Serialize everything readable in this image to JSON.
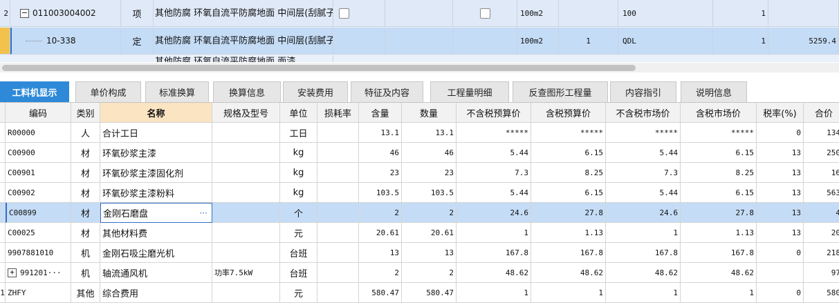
{
  "upper": {
    "rows": [
      {
        "gutter": "2",
        "code": "011003004002",
        "expand": "−",
        "type": "项",
        "name": "其他防腐 环氧自流平防腐地面 中间层(刮腻子)",
        "unit": "100m2",
        "qty_expr": "",
        "qty": "100",
        "col_a": "",
        "count": "1",
        "total": ""
      },
      {
        "gutter": "",
        "code": "10-338",
        "expand": "",
        "type": "定",
        "name": "其他防腐 环氧自流平防腐地面 中间层(刮腻子)",
        "unit": "100m2",
        "qty_expr": "1",
        "qty": "QDL",
        "col_a": "",
        "count": "1",
        "total": "5259.4"
      },
      {
        "gutter": "",
        "code": "",
        "expand": "",
        "type": "",
        "name": "其他防腐 环氧自流平防腐地面 面漆",
        "unit": "",
        "qty_expr": "",
        "qty": "",
        "col_a": "",
        "count": "",
        "total": ""
      }
    ]
  },
  "tabs": [
    {
      "label": "工料机显示",
      "active": true
    },
    {
      "label": "单价构成"
    },
    {
      "label": "标准换算"
    },
    {
      "label": "换算信息"
    },
    {
      "label": "安装费用"
    },
    {
      "label": "特征及内容"
    },
    {
      "label": "工程量明细"
    },
    {
      "label": "反查图形工程量"
    },
    {
      "label": "内容指引"
    },
    {
      "label": "说明信息"
    }
  ],
  "lower": {
    "headers": [
      "编码",
      "类别",
      "名称",
      "规格及型号",
      "单位",
      "损耗率",
      "含量",
      "数量",
      "不含税预算价",
      "含税预算价",
      "不含税市场价",
      "含税市场价",
      "税率(%)",
      "合价"
    ],
    "rows": [
      {
        "gutter": "",
        "code": "R00000",
        "cat": "人",
        "name": "合计工日",
        "spec": "",
        "unit": "工日",
        "loss": "",
        "content": "13.1",
        "qty": "13.1",
        "p1": "*****",
        "p2": "*****",
        "p3": "*****",
        "p4": "*****",
        "tax": "0",
        "sum": "134"
      },
      {
        "gutter": "",
        "code": "C00900",
        "cat": "材",
        "name": "环氧砂浆主漆",
        "spec": "",
        "unit": "kg",
        "loss": "",
        "content": "46",
        "qty": "46",
        "p1": "5.44",
        "p2": "6.15",
        "p3": "5.44",
        "p4": "6.15",
        "tax": "13",
        "sum": "250"
      },
      {
        "gutter": "",
        "code": "C00901",
        "cat": "材",
        "name": "环氧砂浆主漆固化剂",
        "spec": "",
        "unit": "kg",
        "loss": "",
        "content": "23",
        "qty": "23",
        "p1": "7.3",
        "p2": "8.25",
        "p3": "7.3",
        "p4": "8.25",
        "tax": "13",
        "sum": "16"
      },
      {
        "gutter": "",
        "code": "C00902",
        "cat": "材",
        "name": "环氧砂浆主漆粉料",
        "spec": "",
        "unit": "kg",
        "loss": "",
        "content": "103.5",
        "qty": "103.5",
        "p1": "5.44",
        "p2": "6.15",
        "p3": "5.44",
        "p4": "6.15",
        "tax": "13",
        "sum": "563"
      },
      {
        "gutter": "",
        "code": "C00899",
        "cat": "材",
        "name": "金刚石磨盘",
        "spec": "",
        "unit": "个",
        "loss": "",
        "content": "2",
        "qty": "2",
        "p1": "24.6",
        "p2": "27.8",
        "p3": "24.6",
        "p4": "27.8",
        "tax": "13",
        "sum": "4",
        "selected": true
      },
      {
        "gutter": "",
        "code": "C00025",
        "cat": "材",
        "name": "其他材料费",
        "spec": "",
        "unit": "元",
        "loss": "",
        "content": "20.61",
        "qty": "20.61",
        "p1": "1",
        "p2": "1.13",
        "p3": "1",
        "p4": "1.13",
        "tax": "13",
        "sum": "20"
      },
      {
        "gutter": "",
        "code": "9907881010",
        "cat": "机",
        "name": "金刚石吸尘磨光机",
        "spec": "",
        "unit": "台班",
        "loss": "",
        "content": "13",
        "qty": "13",
        "p1": "167.8",
        "p2": "167.8",
        "p3": "167.8",
        "p4": "167.8",
        "tax": "0",
        "sum": "218"
      },
      {
        "gutter": "",
        "code": "991201···",
        "expand": "+",
        "cat": "机",
        "name": "轴流通风机",
        "spec": "功率7.5kW",
        "unit": "台班",
        "loss": "",
        "content": "2",
        "qty": "2",
        "p1": "48.62",
        "p2": "48.62",
        "p3": "48.62",
        "p4": "48.62",
        "tax": "",
        "sum": "97"
      },
      {
        "gutter": "1",
        "code": "ZHFY",
        "cat": "其他",
        "name": "综合费用",
        "spec": "",
        "unit": "元",
        "loss": "",
        "content": "580.47",
        "qty": "580.47",
        "p1": "1",
        "p2": "1",
        "p3": "1",
        "p4": "1",
        "tax": "0",
        "sum": "580"
      }
    ],
    "ellipsis": "···"
  },
  "colors": {
    "accent": "#2e8ad8",
    "selected_row": "#c5dcf6",
    "name_header": "#fbe4c2"
  }
}
